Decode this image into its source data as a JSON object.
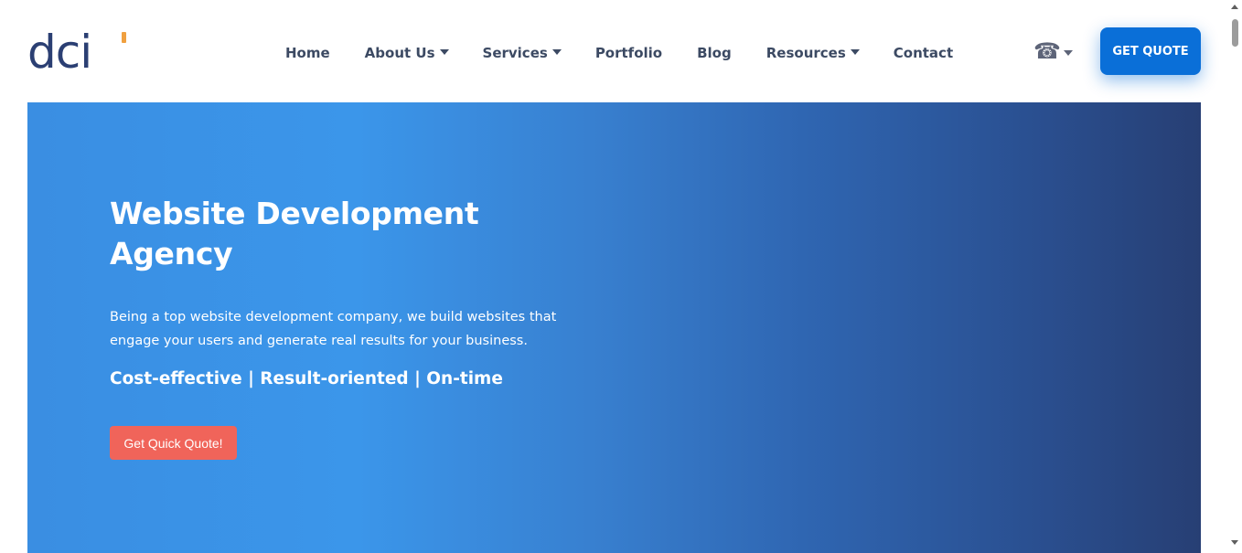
{
  "header": {
    "logo_text": "dci",
    "logo_accent_color": "#f0a040",
    "nav": [
      {
        "label": "Home",
        "has_dropdown": false
      },
      {
        "label": "About Us",
        "has_dropdown": true
      },
      {
        "label": "Services",
        "has_dropdown": true
      },
      {
        "label": "Portfolio",
        "has_dropdown": false
      },
      {
        "label": "Blog",
        "has_dropdown": false
      },
      {
        "label": "Resources",
        "has_dropdown": true
      },
      {
        "label": "Contact",
        "has_dropdown": false
      }
    ],
    "phone_icon": "phone-icon",
    "phone_glyph": "☎",
    "cta_label": "GET QUOTE",
    "cta_color": "#0a6fd8"
  },
  "hero": {
    "title": "Website Development Agency",
    "description": "Being a top website development company, we build websites that engage your users and generate real results for your business.",
    "tagline": "Cost-effective | Result-oriented | On-time",
    "button_label": "Get Quick Quote!",
    "button_color": "#f0645a",
    "gradient_start": "#3a8ee2",
    "gradient_end": "#273f74"
  }
}
